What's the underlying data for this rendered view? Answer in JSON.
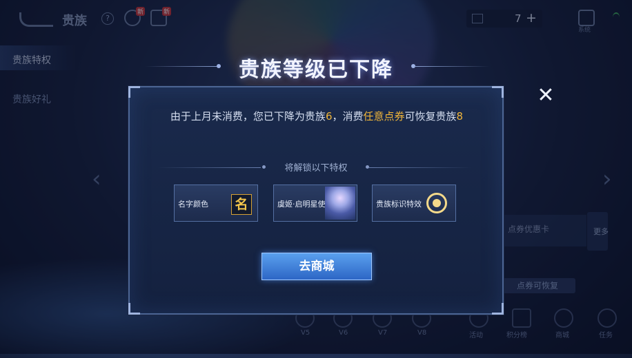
{
  "topbar": {
    "title": "贵族",
    "help": "?",
    "badge_new_1": "新",
    "badge_new_2": "新",
    "coupon_value": "7",
    "coupon_plus": "+",
    "settings_label": "系统"
  },
  "nav": {
    "items": [
      {
        "label": "贵族特权"
      },
      {
        "label": "贵族好礼"
      }
    ]
  },
  "background": {
    "card_title": "点券优惠卡",
    "more_label": "更多",
    "restore_label": "点券可恢复",
    "bottom_items": [
      {
        "label": "V5"
      },
      {
        "label": "V6"
      },
      {
        "label": "V7"
      },
      {
        "label": "V8"
      },
      {
        "label": "活动"
      },
      {
        "label": "积分榜"
      },
      {
        "label": "商城"
      },
      {
        "label": "任务"
      }
    ]
  },
  "dialog": {
    "title": "贵族等级已下降",
    "msg_part1": "由于上月未消费，您已下降为贵族",
    "msg_level_down": "6",
    "msg_part2": "，消费",
    "msg_highlight": "任意点券",
    "msg_part3": "可恢复贵族",
    "msg_level_restore": "8",
    "perks_heading": "将解锁以下特权",
    "perks": [
      {
        "label": "名字颜色",
        "icon_char": "名",
        "icon": "name-color-icon"
      },
      {
        "label": "虞姬·启明星使",
        "icon": "hero-skin-portrait"
      },
      {
        "label": "贵族标识特效",
        "icon": "noble-emblem-icon"
      }
    ],
    "shop_button": "去商城",
    "close_icon": "close-icon"
  },
  "colors": {
    "highlight": "#f0b53a",
    "button_blue": "#2d66c5",
    "dialog_bg": "#1a2a4c"
  }
}
